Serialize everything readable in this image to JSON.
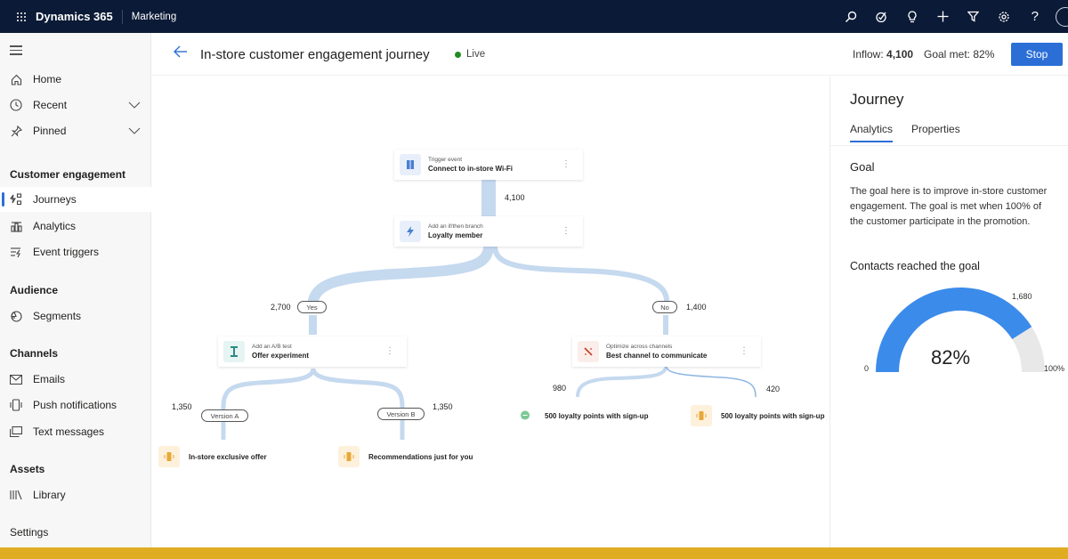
{
  "topbar": {
    "brand": "Dynamics 365",
    "app": "Marketing",
    "icons": [
      "search-icon",
      "task-icon",
      "lightbulb-icon",
      "plus-icon",
      "filter-icon",
      "settings-icon",
      "help-icon",
      "avatar"
    ]
  },
  "sidebar": {
    "items": [
      {
        "label": "Home",
        "icon": "home-icon"
      },
      {
        "label": "Recent",
        "icon": "clock-icon"
      },
      {
        "label": "Pinned",
        "icon": "pin-icon"
      }
    ],
    "sections": [
      {
        "title": "Customer engagement",
        "items": [
          {
            "label": "Journeys",
            "icon": "journey-icon",
            "active": true
          },
          {
            "label": "Analytics",
            "icon": "analytics-icon"
          },
          {
            "label": "Event triggers",
            "icon": "event-trigger-icon"
          }
        ]
      },
      {
        "title": "Audience",
        "items": [
          {
            "label": "Segments",
            "icon": "segments-icon"
          }
        ]
      },
      {
        "title": "Channels",
        "items": [
          {
            "label": "Emails",
            "icon": "email-icon"
          },
          {
            "label": "Push notifications",
            "icon": "push-notification-icon"
          },
          {
            "label": "Text messages",
            "icon": "text-message-icon"
          }
        ]
      },
      {
        "title": "Assets",
        "items": [
          {
            "label": "Library",
            "icon": "library-icon"
          }
        ]
      },
      {
        "title": "Settings",
        "items": []
      }
    ]
  },
  "header": {
    "title": "In-store customer engagement journey",
    "status": "Live",
    "status_color": "#228b22",
    "inflow_label": "Inflow:",
    "inflow_value": "4,100",
    "goal_met": "Goal met: 82%",
    "stop_label": "Stop"
  },
  "journey": {
    "trigger": {
      "sub": "Trigger event",
      "main": "Connect to in-store Wi-Fi"
    },
    "trigger_count": "4,100",
    "branch": {
      "sub": "Add an if/then branch",
      "main": "Loyalty member"
    },
    "yes_count": "2,700",
    "yes_label": "Yes",
    "no_label": "No",
    "no_count": "1,400",
    "abtest": {
      "sub": "Add an A/B test",
      "main": "Offer experiment"
    },
    "optimize": {
      "sub": "Optimize across channels",
      "main": "Best channel to communicate"
    },
    "version_a_count": "1,350",
    "version_a_label": "Version A",
    "version_b_label": "Version B",
    "version_b_count": "1,350",
    "channel_left_count": "980",
    "channel_right_count": "420",
    "leaves": [
      {
        "label": "In-store exclusive offer",
        "icon": "push-notification-icon"
      },
      {
        "label": "Recommendations just for you",
        "icon": "push-notification-icon"
      },
      {
        "label": "500 loyalty points with sign-up",
        "icon": "text-message-icon"
      },
      {
        "label": "500 loyalty points with sign-up",
        "icon": "push-notification-icon"
      }
    ]
  },
  "panel": {
    "title": "Journey",
    "tabs": [
      {
        "label": "Analytics",
        "active": true
      },
      {
        "label": "Properties"
      }
    ],
    "goal_heading": "Goal",
    "goal_text": "The goal here is to improve in-store customer engagement. The goal is met when 100% of the customer participate in the promotion.",
    "contacts_heading": "Contacts reached the goal",
    "gauge": {
      "percent": 82,
      "percent_label": "82%",
      "min_label": "0",
      "max_label": "100%",
      "target_label": "1,680",
      "fill_color": "#3b8beb",
      "track_color": "#e8e8e8"
    }
  },
  "colors": {
    "topbar": "#0b1a36",
    "accent": "#2b6fd6",
    "flow": "#c5d9ef",
    "footer_bar": "#e0ad22"
  }
}
